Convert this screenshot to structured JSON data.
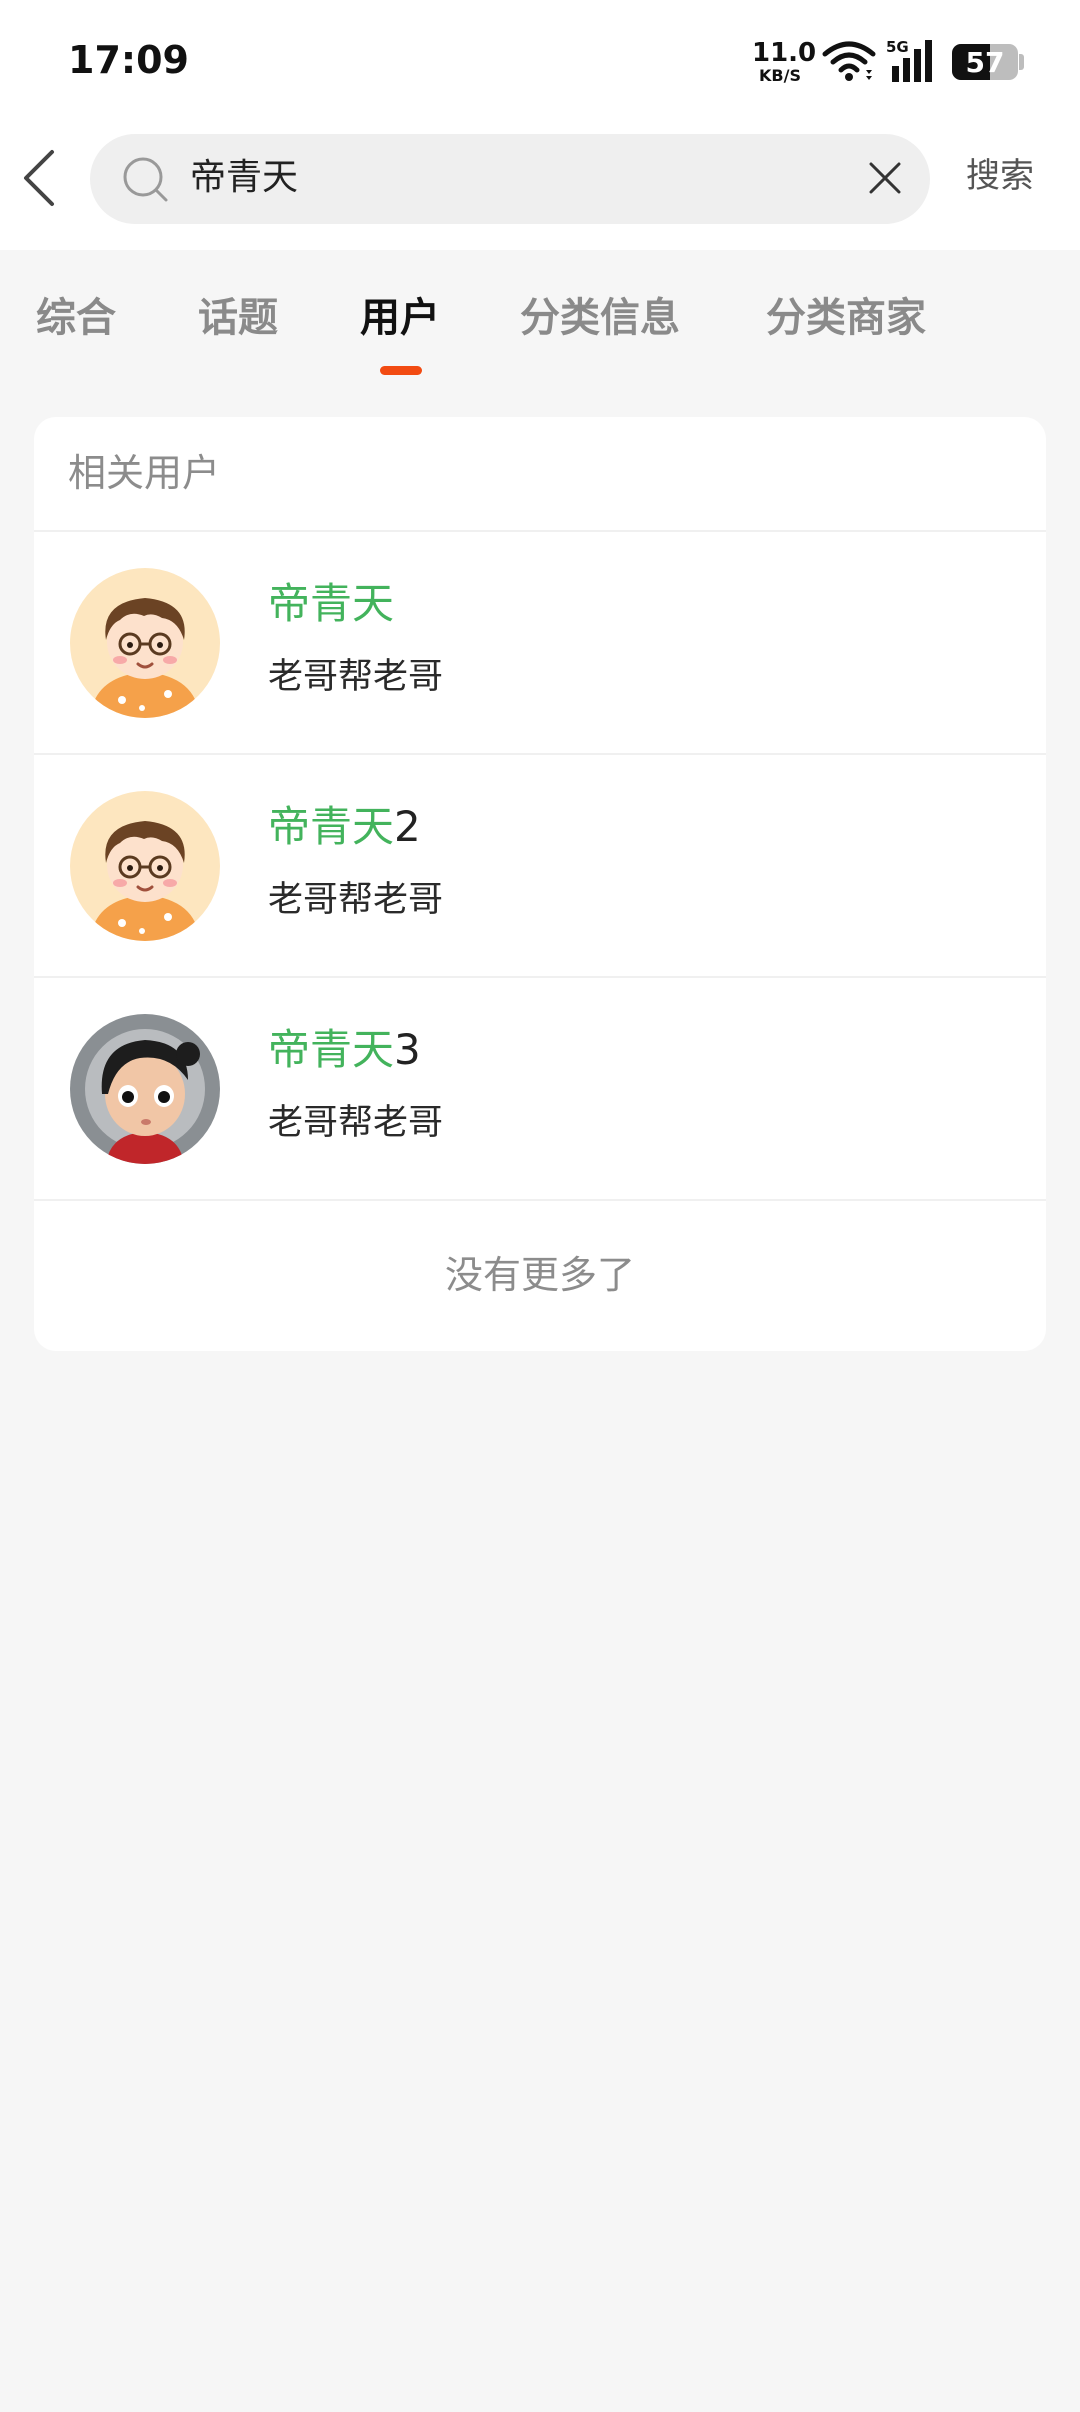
{
  "status_bar": {
    "time": "17:09",
    "net_speed_value": "11.0",
    "net_speed_unit": "KB/S",
    "network_type": "5G",
    "battery_level": "57"
  },
  "search": {
    "query": "帝青天",
    "submit_label": "搜索"
  },
  "tabs": [
    {
      "label": "综合",
      "active": false
    },
    {
      "label": "话题",
      "active": false
    },
    {
      "label": "用户",
      "active": true
    },
    {
      "label": "分类信息",
      "active": false
    },
    {
      "label": "分类商家",
      "active": false
    }
  ],
  "results": {
    "section_title": "相关用户",
    "users": [
      {
        "name_highlight": "帝青天",
        "name_suffix": "",
        "description": "老哥帮老哥",
        "avatar": "cartoon-boy-glasses-avatar"
      },
      {
        "name_highlight": "帝青天",
        "name_suffix": "2",
        "description": "老哥帮老哥",
        "avatar": "cartoon-boy-glasses-avatar"
      },
      {
        "name_highlight": "帝青天",
        "name_suffix": "3",
        "description": "老哥帮老哥",
        "avatar": "cartoon-girl-avatar"
      }
    ],
    "end_text": "没有更多了"
  },
  "colors": {
    "accent": "#f24b12",
    "highlight": "#43b35c",
    "background": "#f6f6f6"
  }
}
